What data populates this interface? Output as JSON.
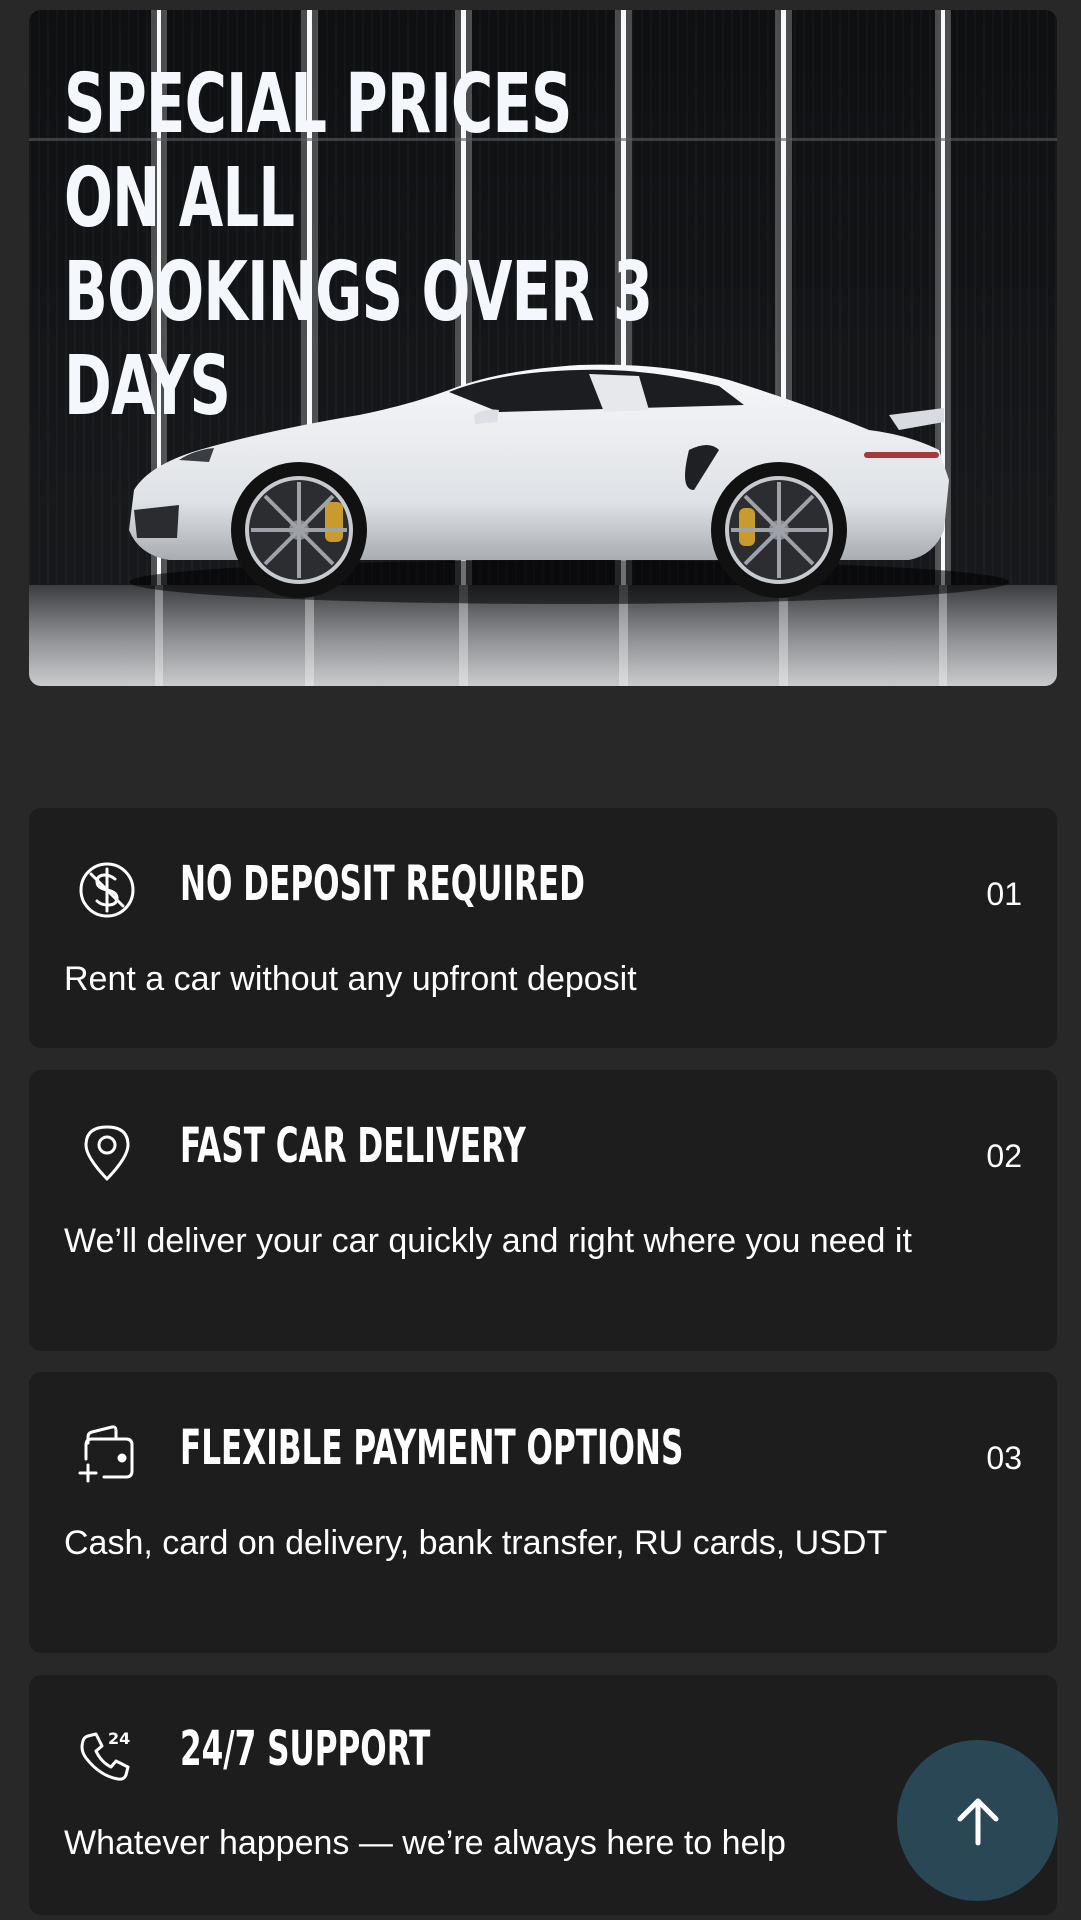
{
  "hero": {
    "title": "SPECIAL PRICES ON ALL\nBOOKINGS OVER 3 DAYS",
    "image": "white sports car in studio"
  },
  "features": [
    {
      "icon": "no-dollar-icon",
      "title": "NO DEPOSIT REQUIRED",
      "number": "01",
      "description": "Rent a car without any upfront deposit"
    },
    {
      "icon": "location-pin-icon",
      "title": "FAST CAR DELIVERY",
      "number": "02",
      "description": "We’ll deliver your car quickly and right where you need it"
    },
    {
      "icon": "wallet-plus-icon",
      "title": "FLEXIBLE PAYMENT OPTIONS",
      "number": "03",
      "description": "Cash, card on delivery, bank transfer, RU cards, USDT"
    },
    {
      "icon": "phone-24-icon",
      "title": "24/7 SUPPORT",
      "number": "",
      "description": "Whatever happens — we’re always here to help"
    }
  ],
  "scroll_top": {
    "icon": "arrow-up-icon"
  },
  "colors": {
    "background": "#282828",
    "card": "#1d1d1e",
    "fab": "#2a4756",
    "text": "#ffffff"
  }
}
